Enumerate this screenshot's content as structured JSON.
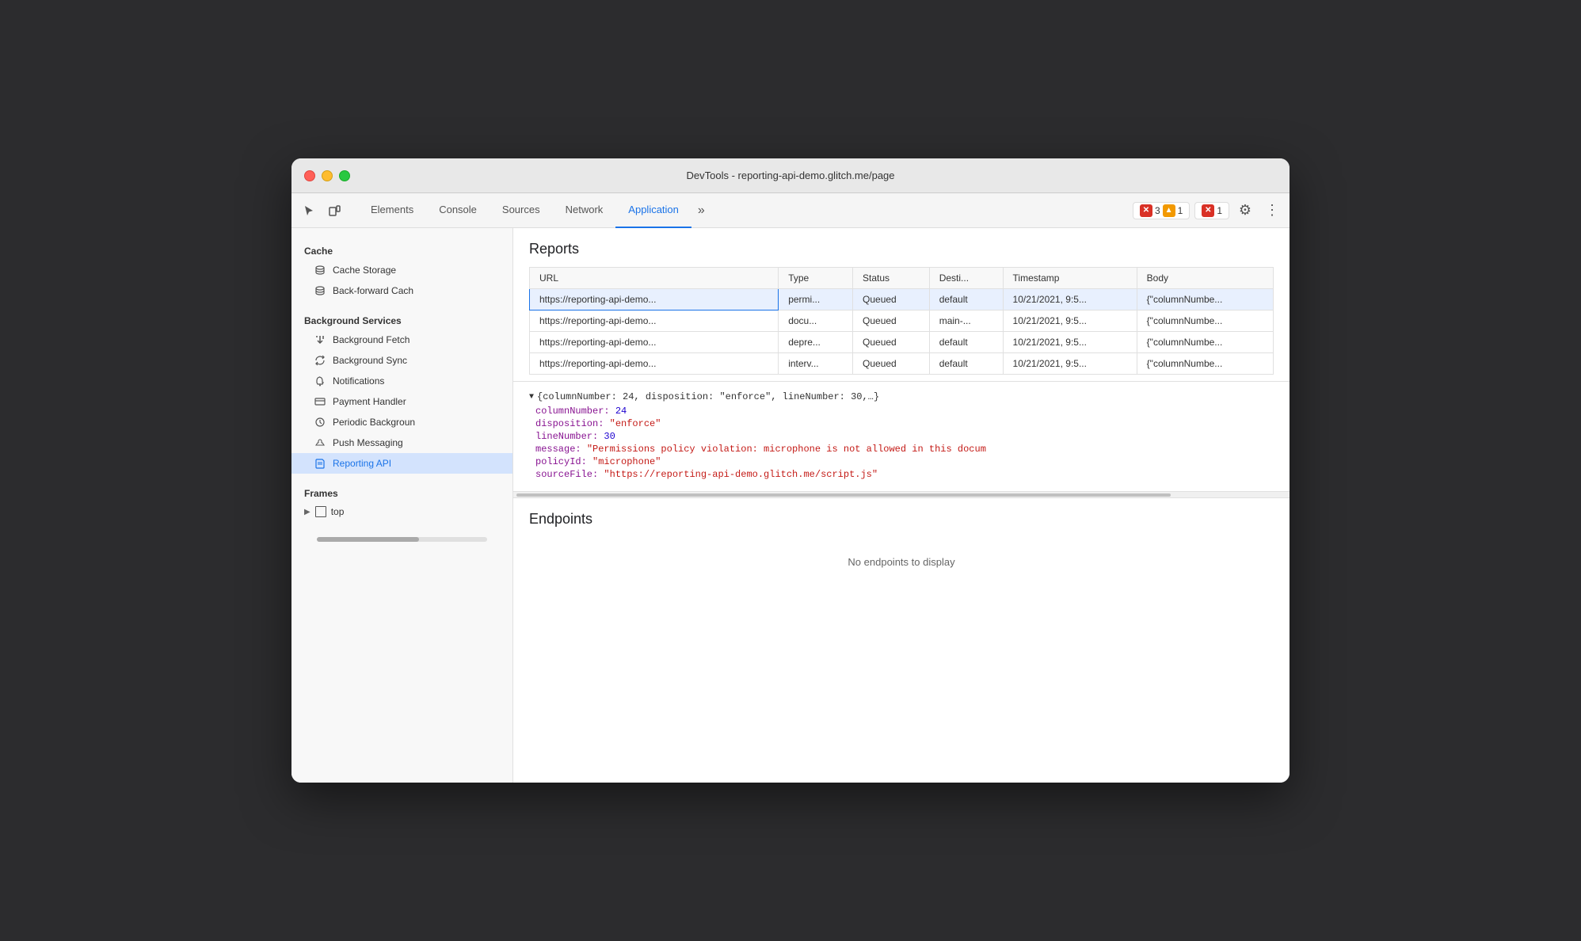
{
  "window": {
    "title": "DevTools - reporting-api-demo.glitch.me/page"
  },
  "toolbar": {
    "icons": [
      "cursor-icon",
      "device-icon"
    ],
    "tabs": [
      {
        "label": "Elements",
        "active": false
      },
      {
        "label": "Console",
        "active": false
      },
      {
        "label": "Sources",
        "active": false
      },
      {
        "label": "Network",
        "active": false
      },
      {
        "label": "Application",
        "active": true
      }
    ],
    "overflow_label": "»",
    "badges": [
      {
        "icon": "✕",
        "color": "red",
        "count": "3"
      },
      {
        "icon": "▲",
        "color": "yellow",
        "count": "1"
      },
      {
        "icon": "✕",
        "color": "red",
        "count": "1"
      }
    ],
    "gear_label": "⚙",
    "more_label": "⋮"
  },
  "sidebar": {
    "sections": [
      {
        "title": "Cache",
        "items": [
          {
            "label": "Cache Storage",
            "icon": "storage"
          },
          {
            "label": "Back-forward Cach",
            "icon": "storage"
          }
        ]
      },
      {
        "title": "Background Services",
        "items": [
          {
            "label": "Background Fetch",
            "icon": "fetch"
          },
          {
            "label": "Background Sync",
            "icon": "sync"
          },
          {
            "label": "Notifications",
            "icon": "bell"
          },
          {
            "label": "Payment Handler",
            "icon": "card"
          },
          {
            "label": "Periodic Backgroun",
            "icon": "clock"
          },
          {
            "label": "Push Messaging",
            "icon": "cloud"
          },
          {
            "label": "Reporting API",
            "icon": "doc",
            "active": true
          }
        ]
      },
      {
        "title": "Frames",
        "items": [
          {
            "label": "top",
            "icon": "frame"
          }
        ]
      }
    ]
  },
  "panel": {
    "reports_title": "Reports",
    "table": {
      "headers": [
        "URL",
        "Type",
        "Status",
        "Desti...",
        "Timestamp",
        "Body"
      ],
      "rows": [
        {
          "url": "https://reporting-api-demo...",
          "type": "permi...",
          "status": "Queued",
          "destination": "default",
          "timestamp": "10/21/2021, 9:5...",
          "body": "{\"columnNumbe...",
          "selected": true
        },
        {
          "url": "https://reporting-api-demo...",
          "type": "docu...",
          "status": "Queued",
          "destination": "main-...",
          "timestamp": "10/21/2021, 9:5...",
          "body": "{\"columnNumbe...",
          "selected": false
        },
        {
          "url": "https://reporting-api-demo...",
          "type": "depre...",
          "status": "Queued",
          "destination": "default",
          "timestamp": "10/21/2021, 9:5...",
          "body": "{\"columnNumbe...",
          "selected": false
        },
        {
          "url": "https://reporting-api-demo...",
          "type": "interv...",
          "status": "Queued",
          "destination": "default",
          "timestamp": "10/21/2021, 9:5...",
          "body": "{\"columnNumbe...",
          "selected": false
        }
      ]
    },
    "detail": {
      "header": "{columnNumber: 24, disposition: \"enforce\", lineNumber: 30,…}",
      "fields": [
        {
          "key": "columnNumber",
          "value": "24",
          "type": "number"
        },
        {
          "key": "disposition",
          "value": "\"enforce\"",
          "type": "string"
        },
        {
          "key": "lineNumber",
          "value": "30",
          "type": "number"
        },
        {
          "key": "message",
          "value": "\"Permissions policy violation: microphone is not allowed in this docum",
          "type": "string"
        },
        {
          "key": "policyId",
          "value": "\"microphone\"",
          "type": "string"
        },
        {
          "key": "sourceFile",
          "value": "\"https://reporting-api-demo.glitch.me/script.js\"",
          "type": "string"
        }
      ]
    },
    "endpoints_title": "Endpoints",
    "no_endpoints_text": "No endpoints to display"
  }
}
